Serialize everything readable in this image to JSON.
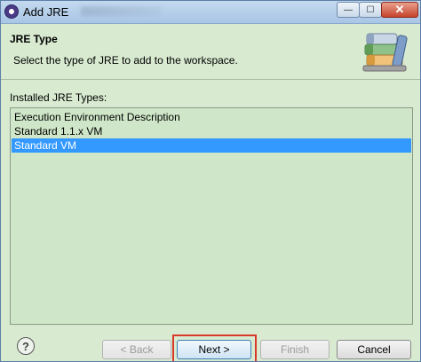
{
  "window": {
    "title": "Add JRE"
  },
  "header": {
    "title": "JRE Type",
    "description": "Select the type of JRE to add to the workspace."
  },
  "list": {
    "label": "Installed JRE Types:",
    "items": [
      "Execution Environment Description",
      "Standard 1.1.x VM",
      "Standard VM"
    ],
    "selected_index": 2
  },
  "buttons": {
    "help": "?",
    "back": "< Back",
    "next": "Next >",
    "finish": "Finish",
    "cancel": "Cancel"
  },
  "titlebar_buttons": {
    "minimize": "—",
    "maximize": "☐",
    "close": "✕"
  },
  "colors": {
    "selection": "#3399ff",
    "panel": "#d8ead0",
    "highlight": "#d83a2a"
  }
}
